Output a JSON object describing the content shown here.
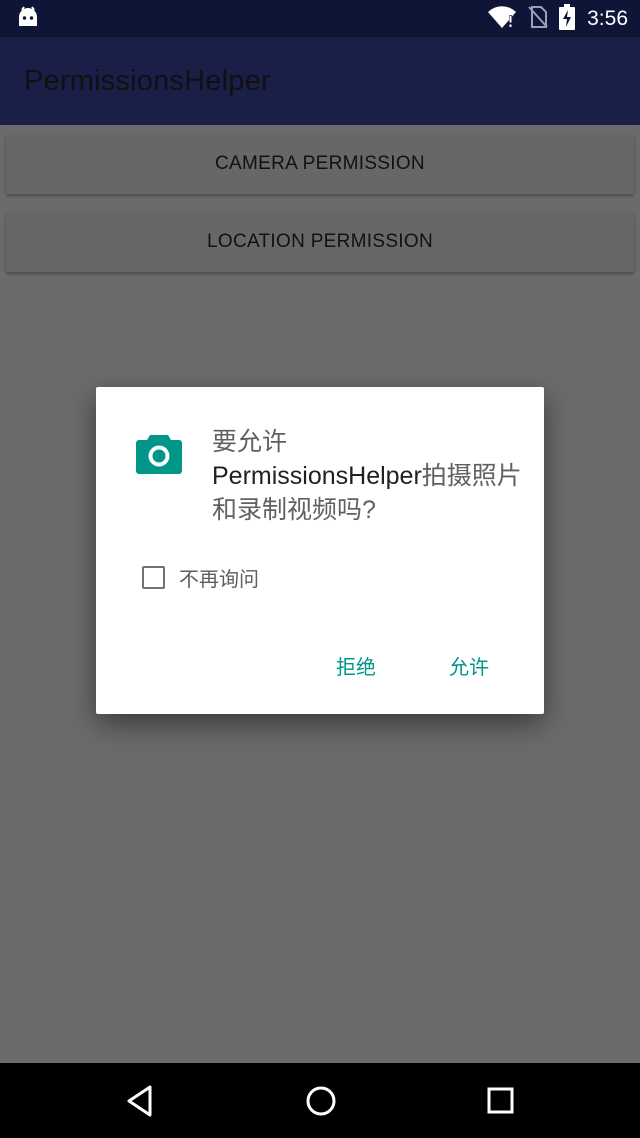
{
  "status_bar": {
    "time": "3:56",
    "icons": [
      "android-debug-icon",
      "wifi-icon",
      "no-sim-icon",
      "battery-charging-icon"
    ]
  },
  "app_bar": {
    "title": "PermissionsHelper"
  },
  "buttons": {
    "camera": "CAMERA PERMISSION",
    "location": "LOCATION PERMISSION"
  },
  "dialog": {
    "icon": "camera-icon",
    "message_prefix": "要允许",
    "app_name": "PermissionsHelper",
    "message_suffix": "拍摄照片和录制视频吗?",
    "checkbox_label": "不再询问",
    "checkbox_checked": false,
    "deny_label": "拒绝",
    "allow_label": "允许"
  },
  "colors": {
    "status_bar": "#0f1537",
    "app_bar": "#1a1f47",
    "accent": "#009688",
    "scrim_background": "#6b6b6b"
  },
  "nav_bar": {
    "icons": [
      "back-icon",
      "home-icon",
      "recents-icon"
    ]
  }
}
